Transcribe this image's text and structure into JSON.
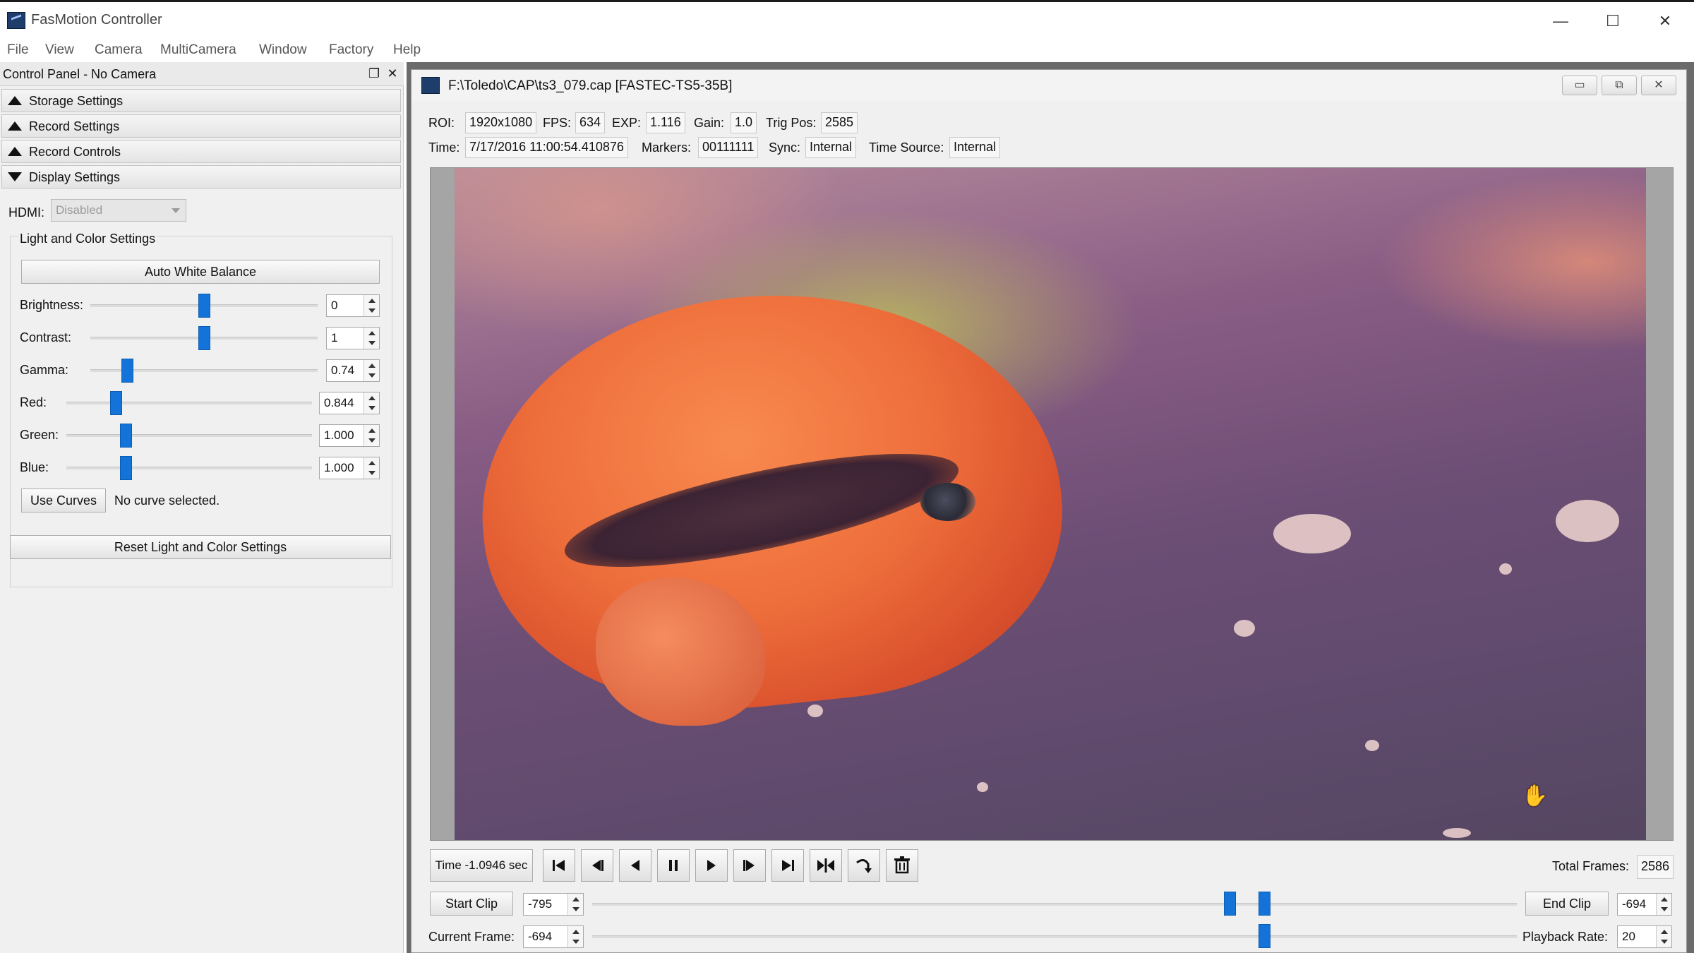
{
  "app": {
    "title": "FasMotion Controller",
    "window_controls": {
      "minimize": "—",
      "maximize": "☐",
      "close": "✕"
    }
  },
  "menu": [
    "File",
    "View",
    "Camera",
    "MultiCamera",
    "Window",
    "Factory",
    "Help"
  ],
  "control_panel": {
    "title": "Control Panel - No Camera",
    "float_icon": "❐",
    "close_icon": "✕",
    "sections": [
      {
        "label": "Storage Settings",
        "state": "collapsed"
      },
      {
        "label": "Record Settings",
        "state": "collapsed"
      },
      {
        "label": "Record Controls",
        "state": "collapsed"
      },
      {
        "label": "Display Settings",
        "state": "expanded"
      }
    ],
    "hdmi": {
      "label": "HDMI:",
      "value": "Disabled"
    },
    "light_color": {
      "group_title": "Light and Color Settings",
      "auto_white_balance": "Auto White Balance",
      "sliders": [
        {
          "label": "Brightness:",
          "value": "0",
          "level": 0.5
        },
        {
          "label": "Contrast:",
          "value": "1",
          "level": 0.5
        },
        {
          "label": "Gamma:",
          "value": "0.74",
          "level": 0.16
        },
        {
          "label": "Red:",
          "value": "0.844",
          "level": 0.2
        },
        {
          "label": "Green:",
          "value": "1.000",
          "level": 0.24
        },
        {
          "label": "Blue:",
          "value": "1.000",
          "level": 0.24
        }
      ],
      "use_curves": "Use Curves",
      "curve_status": "No curve selected.",
      "reset": "Reset Light and Color Settings"
    }
  },
  "clip_window": {
    "title": "F:\\Toledo\\CAP\\ts3_079.cap [FASTEC-TS5-35B]",
    "controls": {
      "minimize": "▭",
      "restore": "⧉",
      "close": "✕"
    },
    "info_row1": [
      {
        "label": "ROI:",
        "value": "1920x1080"
      },
      {
        "label": "FPS:",
        "value": "634"
      },
      {
        "label": "EXP:",
        "value": "1.116"
      },
      {
        "label": "Gain:",
        "value": "1.0"
      },
      {
        "label": "Trig Pos:",
        "value": "2585"
      }
    ],
    "info_row2": [
      {
        "label": "Time:",
        "value": "7/17/2016 11:00:54.410876"
      },
      {
        "label": "Markers:",
        "value": "00111111"
      },
      {
        "label": "Sync:",
        "value": "Internal"
      },
      {
        "label": "Time Source:",
        "value": "Internal"
      }
    ],
    "playback": {
      "time_display": "Time -1.0946 sec",
      "buttons": [
        "skip-to-start",
        "step-back",
        "play-reverse",
        "pause",
        "play",
        "step-forward",
        "skip-to-end",
        "mark-clip",
        "export",
        "delete"
      ],
      "total_frames_label": "Total Frames:",
      "total_frames": "2586",
      "start_clip_label": "Start Clip",
      "start_clip_value": "-795",
      "end_clip_label": "End Clip",
      "end_clip_value": "-694",
      "current_frame_label": "Current Frame:",
      "current_frame_value": "-694",
      "playback_rate_label": "Playback Rate:",
      "playback_rate_value": "20",
      "clip_range": {
        "start_frac": 0.689,
        "end_frac": 0.727
      },
      "current_frac": 0.727
    }
  },
  "colors": {
    "accent": "#1373d8",
    "mdi_background": "#6b6b6b"
  }
}
